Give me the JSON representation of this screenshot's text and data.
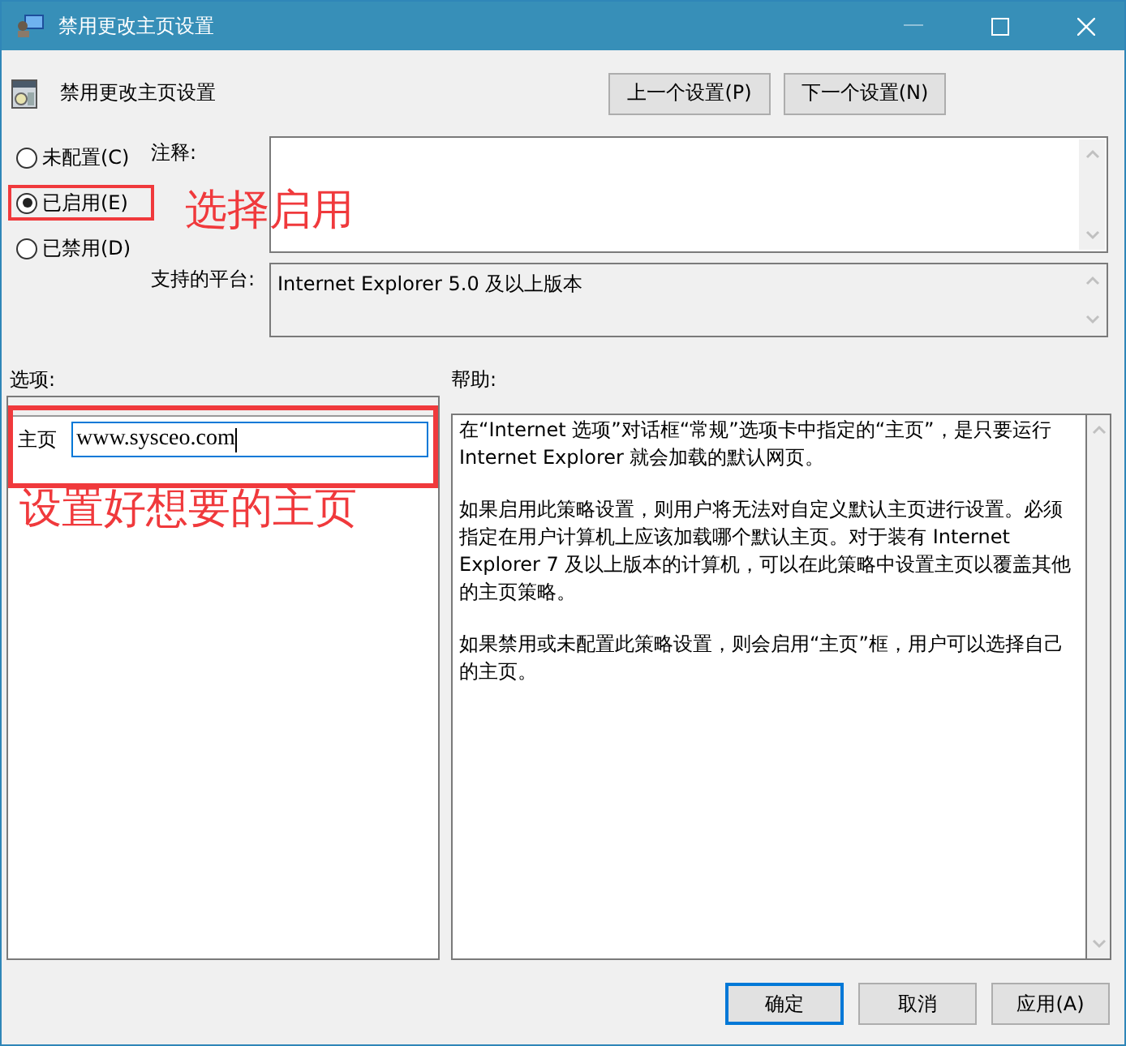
{
  "window": {
    "title": "禁用更改主页设置"
  },
  "header": {
    "title": "禁用更改主页设置",
    "buttons": [
      {
        "label": "上一个设置(P)"
      },
      {
        "label": "下一个设置(N)"
      }
    ]
  },
  "state_options": [
    {
      "label": "未配置(C)",
      "selected": false
    },
    {
      "label": "已启用(E)",
      "selected": true
    },
    {
      "label": "已禁用(D)",
      "selected": false
    }
  ],
  "comment": {
    "label": "注释:"
  },
  "platform": {
    "label": "支持的平台:",
    "value": "Internet Explorer 5.0 及以上版本"
  },
  "options": {
    "label": "选项:",
    "fields": [
      {
        "label": "主页",
        "value": "www.sysceo.com"
      }
    ]
  },
  "help": {
    "label": "帮助:",
    "paragraphs": [
      "在“Internet 选项”对话框“常规”选项卡中指定的“主页”，是只要运行 Internet Explorer 就会加载的默认网页。",
      "如果启用此策略设置，则用户将无法对自定义默认主页进行设置。必须指定在用户计算机上应该加载哪个默认主页。对于装有 Internet Explorer 7 及以上版本的计算机，可以在此策略中设置主页以覆盖其他的主页策略。",
      "如果禁用或未配置此策略设置，则会启用“主页”框，用户可以选择自己的主页。"
    ]
  },
  "footer_buttons": [
    {
      "label": "确定",
      "default": true
    },
    {
      "label": "取消",
      "default": false
    },
    {
      "label": "应用(A)",
      "default": false
    }
  ],
  "annotations": [
    {
      "text": "选择启用"
    },
    {
      "text": "设置好想要的主页"
    }
  ]
}
